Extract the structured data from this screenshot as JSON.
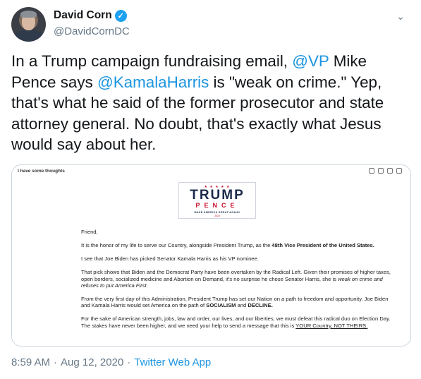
{
  "author": {
    "name": "David Corn",
    "handle": "@DavidCornDC",
    "verified": true
  },
  "tweet": {
    "text_parts": [
      "In a Trump campaign fundraising email, ",
      "@VP",
      " Mike Pence says ",
      "@KamalaHarris",
      " is \"weak on crime.\" Yep, that's what he said of the former prosecutor and state attorney general. No doubt, that's exactly what Jesus would say about her."
    ]
  },
  "media": {
    "subject": "I have some thoughts",
    "logo": {
      "stars": "★ ★ ★ ★ ★",
      "line1": "TRUMP",
      "line2": "PENCE",
      "slogan": "MAKE AMERICA GREAT AGAIN!",
      "year": "2020"
    },
    "email": {
      "greeting": "Friend,",
      "p1_a": "It is the honor of my life to serve our Country, alongside President Trump, as the ",
      "p1_b": "48th Vice President of the United States.",
      "p2": "I see that Joe Biden has picked Senator Kamala Harris as his VP nominee.",
      "p3_a": "That pick shows that Biden and the Democrat Party have been overtaken by the Radical Left. Given their promises of higher taxes, open borders, socialized medicine and Abortion on Demand, it's no surprise he chose Senator Harris, she is ",
      "p3_b": "weak on crime and refuses to put America First.",
      "p4_a": "From the very first day of this Administration, President Trump has set our Nation on a path to freedom and opportunity. Joe Biden and Kamala Harris would set America on the path of ",
      "p4_b": "SOCIALISM",
      "p4_c": " and ",
      "p4_d": "DECLINE.",
      "p5_a": "For the sake of American strength, jobs, law and order, our lives, and our liberties, we must defeat this radical duo on Election Day. The stakes have never been higher, and we need your help to send a message that this is ",
      "p5_b": "YOUR Country, NOT THEIRS."
    }
  },
  "meta": {
    "time": "8:59 AM",
    "sep1": "·",
    "date": "Aug 12, 2020",
    "sep2": "·",
    "source": "Twitter Web App"
  },
  "colors": {
    "link": "#1b95e0",
    "muted": "#657786",
    "verified": "#1da1f2"
  },
  "icons": [
    "verified-badge-icon",
    "chevron-down-icon",
    "print-icon",
    "calendar-icon",
    "copy-icon",
    "trash-icon"
  ]
}
